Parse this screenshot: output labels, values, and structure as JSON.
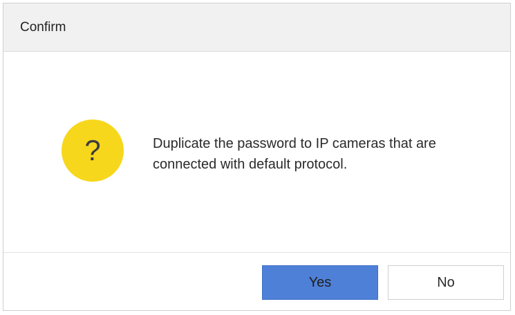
{
  "dialog": {
    "title": "Confirm",
    "icon": "question-mark-icon",
    "icon_glyph": "?",
    "icon_color": "#f6d71c",
    "message_line1": "Duplicate the password to IP cameras that are",
    "message_line2": "connected with default protocol.",
    "buttons": {
      "yes_label": "Yes",
      "no_label": "No"
    },
    "colors": {
      "primary_button": "#4f80d8",
      "titlebar": "#f1f1f1"
    }
  }
}
